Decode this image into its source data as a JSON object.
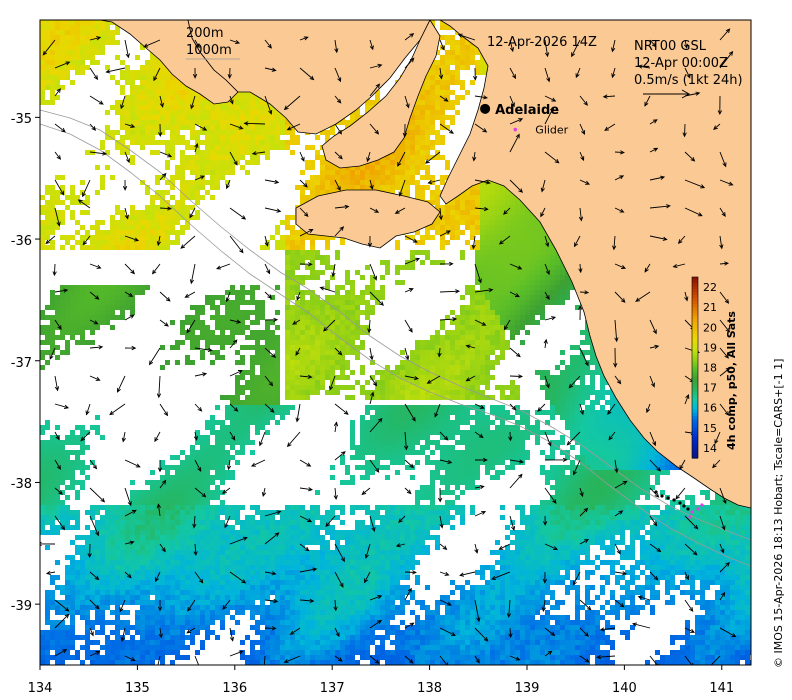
{
  "map": {
    "date_label": "12-Apr-2026 14Z",
    "depth_labels": [
      "200m",
      "1000m"
    ],
    "current_info": [
      "NRT00 GSL",
      "12-Apr 00:00Z",
      "0.5m/s (1kt 24h)"
    ],
    "city": "Adelaide",
    "glider_label": "Glider",
    "credit": "© IMOS 15-Apr-2026 18:13 Hobart; Tscale=CARS+[-1 1]",
    "colorbar_title": "4h comp, p50, All Sats",
    "colorbar_ticks": [
      "14",
      "15",
      "16",
      "17",
      "18",
      "19",
      "20",
      "21",
      "22"
    ],
    "x_ticks": [
      "134",
      "135",
      "136",
      "137",
      "138",
      "139",
      "140",
      "141"
    ],
    "y_ticks": [
      "-35",
      "-36",
      "-37",
      "-38",
      "-39"
    ],
    "land_color": "#fbc994",
    "bounds": {
      "lon_min": 134.0,
      "lon_max": 141.3,
      "lat_min": -39.5,
      "lat_max": -34.2
    },
    "adelaide": {
      "lon": 138.57,
      "lat": -34.93
    },
    "glider": {
      "lon": 138.88,
      "lat": -35.1
    }
  }
}
